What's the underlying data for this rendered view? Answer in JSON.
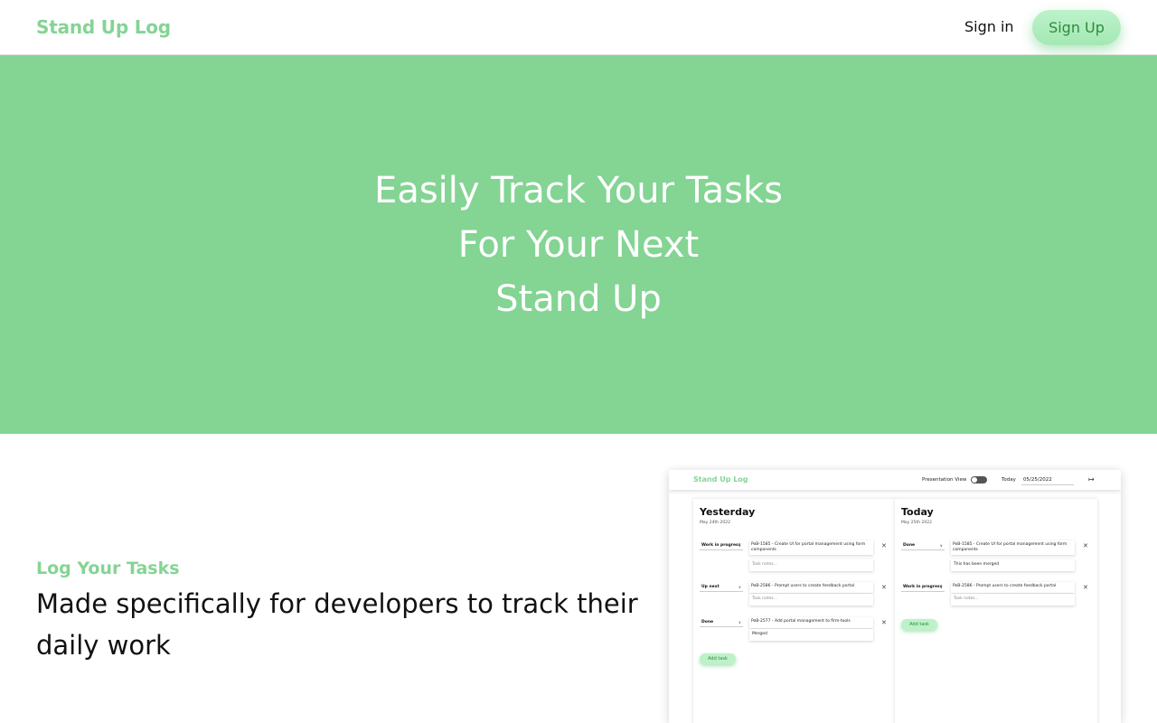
{
  "header": {
    "brand": "Stand Up Log",
    "sign_in": "Sign in",
    "sign_up": "Sign Up"
  },
  "hero": {
    "line1": "Easily Track Your Tasks",
    "line2": "For Your Next",
    "line3": "Stand Up"
  },
  "feature": {
    "kicker": "Log Your Tasks",
    "text": "Made specifically for developers to track their daily work"
  },
  "preview": {
    "brand": "Stand Up Log",
    "presentation_view": "Presentation View",
    "today_label": "Today",
    "date_value": "05/25/2022",
    "logout_icon": "logout-icon",
    "add_task": "Add task",
    "yesterday": {
      "title": "Yesterday",
      "date": "May 24th 2022",
      "tasks": [
        {
          "status": "Work in progress",
          "title": "PoB-1585 - Create UI for portal management using form components",
          "notes": "Task notes..."
        },
        {
          "status": "Up next",
          "title": "PoB-2586 - Prompt users to create feedback portal",
          "notes": "Task notes..."
        },
        {
          "status": "Done",
          "title": "PoB-2577 - Add portal management to firm-tools",
          "notes": "Merged"
        }
      ]
    },
    "today": {
      "title": "Today",
      "date": "May 25th 2022",
      "tasks": [
        {
          "status": "Done",
          "title": "PoB-1585 - Create UI for portal management using form components",
          "notes": "This has been merged"
        },
        {
          "status": "Work in progress",
          "title": "PoB-2586 - Prompt users to create feedback portal",
          "notes": "Task notes..."
        }
      ]
    }
  },
  "colors": {
    "brand_green": "#84d494",
    "button_green": "#bdf2c9",
    "button_text": "#2e8b3e"
  }
}
